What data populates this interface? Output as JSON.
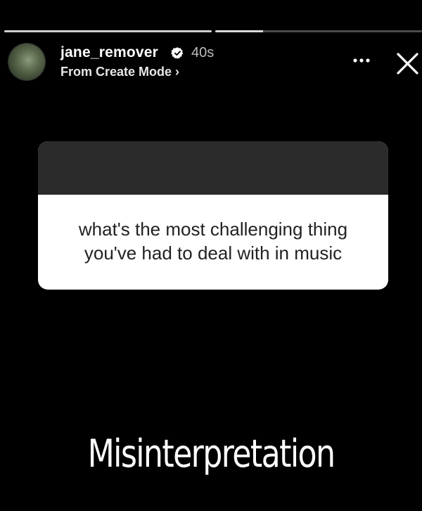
{
  "story": {
    "progress_segments": [
      {
        "state": "complete",
        "fraction": 1.0
      },
      {
        "state": "current",
        "fraction": 0.23
      }
    ]
  },
  "header": {
    "username": "jane_remover",
    "verified": true,
    "time_ago": "40s",
    "subline": "From Create Mode ›",
    "avatar_icon": "profile-photo",
    "more_icon": "ellipsis-icon",
    "close_icon": "close-icon"
  },
  "question_card": {
    "question": "what's the most challenging thing you've had to deal with in music"
  },
  "answer": {
    "text": "Misinterpretation"
  },
  "colors": {
    "background": "#000000",
    "card_header": "#2b2b2b",
    "card_body": "#ffffff",
    "verified_badge": "#ffffff"
  }
}
